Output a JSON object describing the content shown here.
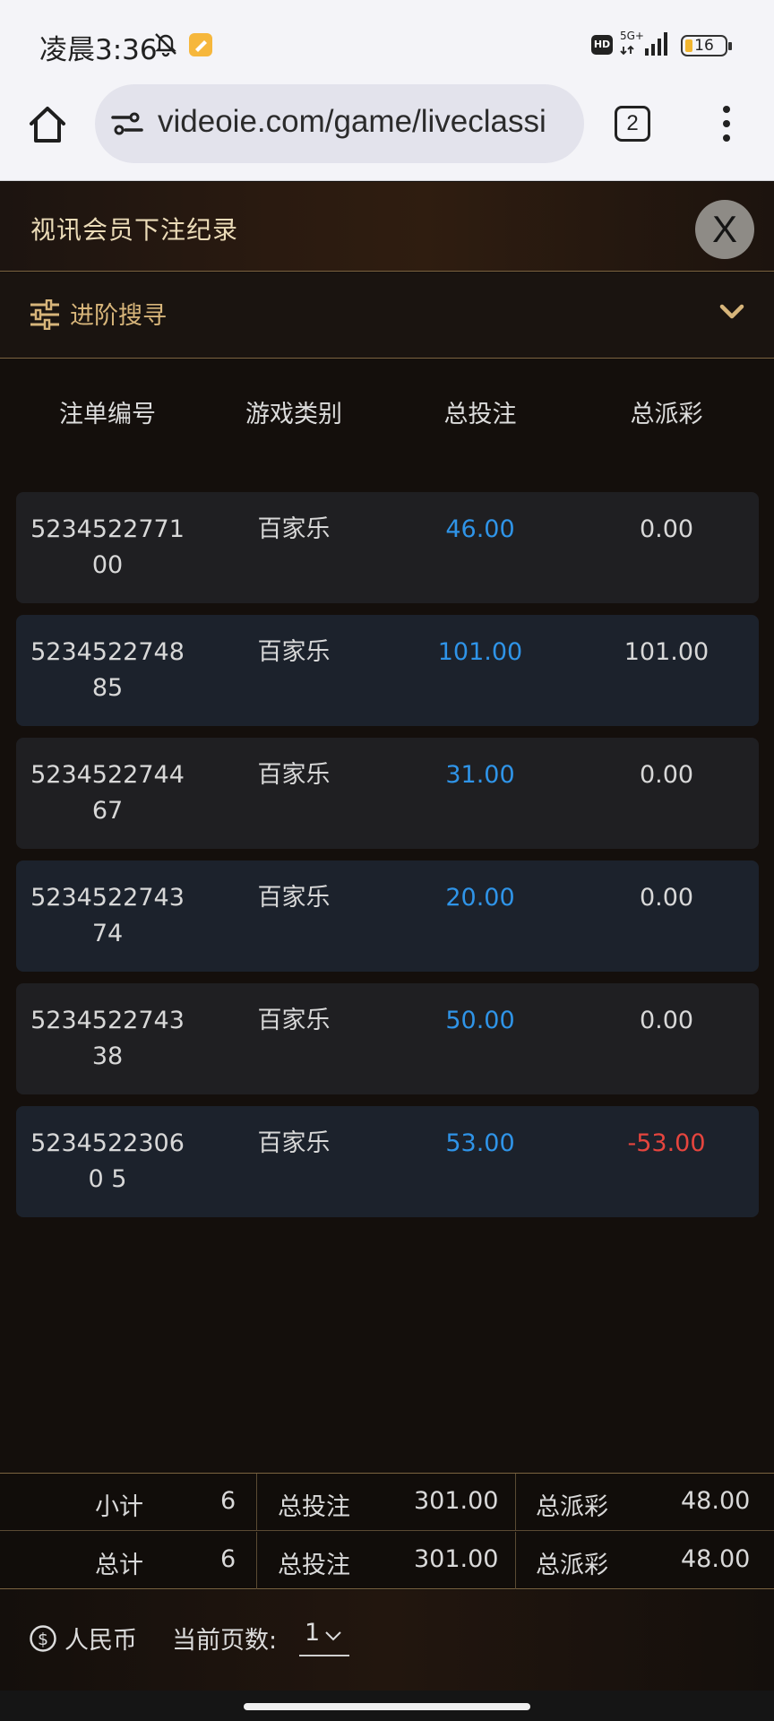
{
  "status_bar": {
    "time": "凌晨3:36",
    "network": "5G+",
    "hd_badge": "HD",
    "battery": "16"
  },
  "browser": {
    "url": "videoie.com/game/liveclassi",
    "tab_count": "2"
  },
  "modal": {
    "title": "视讯会员下注纪录",
    "close_label": "X",
    "search_label": "进阶搜寻"
  },
  "table": {
    "columns": [
      "注单编号",
      "游戏类别",
      "总投注",
      "总派彩"
    ],
    "rows": [
      {
        "id": "523452277100",
        "game": "百家乐",
        "bet": "46.00",
        "payout": "0.00"
      },
      {
        "id": "523452274885",
        "game": "百家乐",
        "bet": "101.00",
        "payout": "101.00"
      },
      {
        "id": "523452274467",
        "game": "百家乐",
        "bet": "31.00",
        "payout": "0.00"
      },
      {
        "id": "523452274374",
        "game": "百家乐",
        "bet": "20.00",
        "payout": "0.00"
      },
      {
        "id": "523452274338",
        "game": "百家乐",
        "bet": "50.00",
        "payout": "0.00"
      },
      {
        "id": "52345223060 5",
        "game": "百家乐",
        "bet": "53.00",
        "payout": "-53.00"
      }
    ]
  },
  "summary": {
    "subtotal": {
      "label": "小计",
      "count": "6",
      "bet_label": "总投注",
      "bet": "301.00",
      "payout_label": "总派彩",
      "payout": "48.00"
    },
    "total": {
      "label": "总计",
      "count": "6",
      "bet_label": "总投注",
      "bet": "301.00",
      "payout_label": "总派彩",
      "payout": "48.00"
    }
  },
  "footer": {
    "currency": "人民币",
    "page_label": "当前页数:",
    "page_value": "1"
  },
  "colors": {
    "accent_gold": "#d7b57a",
    "bet_blue": "#2f94e8",
    "negative_red": "#e6453e"
  }
}
